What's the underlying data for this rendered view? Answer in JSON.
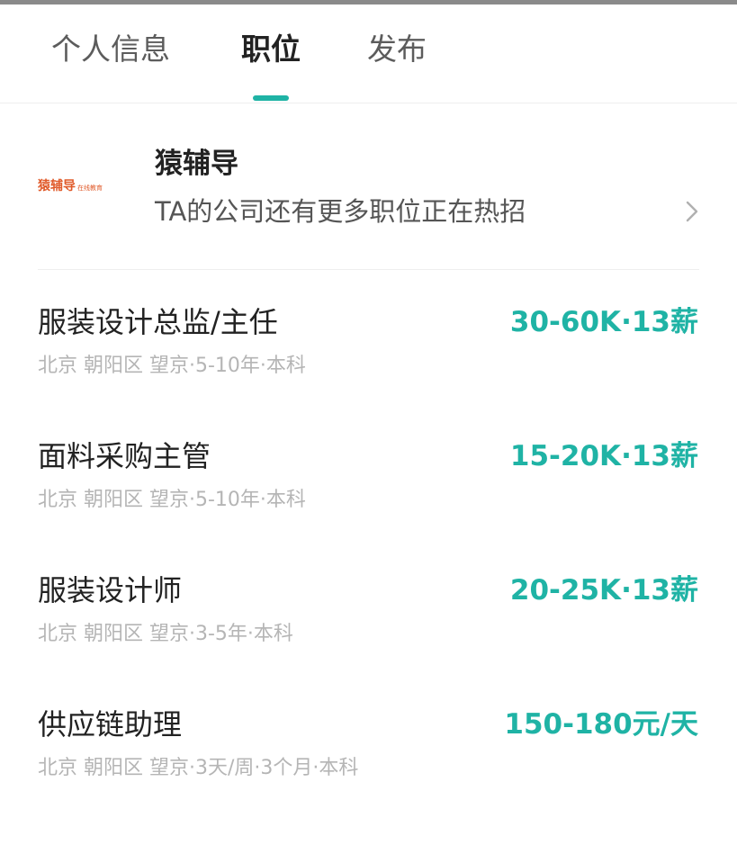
{
  "tabs": [
    {
      "label": "个人信息"
    },
    {
      "label": "职位"
    },
    {
      "label": "发布"
    }
  ],
  "active_tab": "职位",
  "accent_color": "#1fb3a5",
  "company": {
    "logo_text": "猿辅导",
    "logo_subtext": "在线教育",
    "name": "猿辅导",
    "subtitle": "TA的公司还有更多职位正在热招",
    "chevron_icon": "chevron-right-icon"
  },
  "jobs": [
    {
      "title": "服装设计总监/主任",
      "salary": "30-60K·13薪",
      "meta": "北京 朝阳区 望京·5-10年·本科"
    },
    {
      "title": "面料采购主管",
      "salary": "15-20K·13薪",
      "meta": "北京 朝阳区 望京·5-10年·本科"
    },
    {
      "title": "服装设计师",
      "salary": "20-25K·13薪",
      "meta": "北京 朝阳区 望京·3-5年·本科"
    },
    {
      "title": "供应链助理",
      "salary": "150-180元/天",
      "meta": "北京 朝阳区 望京·3天/周·3个月·本科"
    }
  ]
}
